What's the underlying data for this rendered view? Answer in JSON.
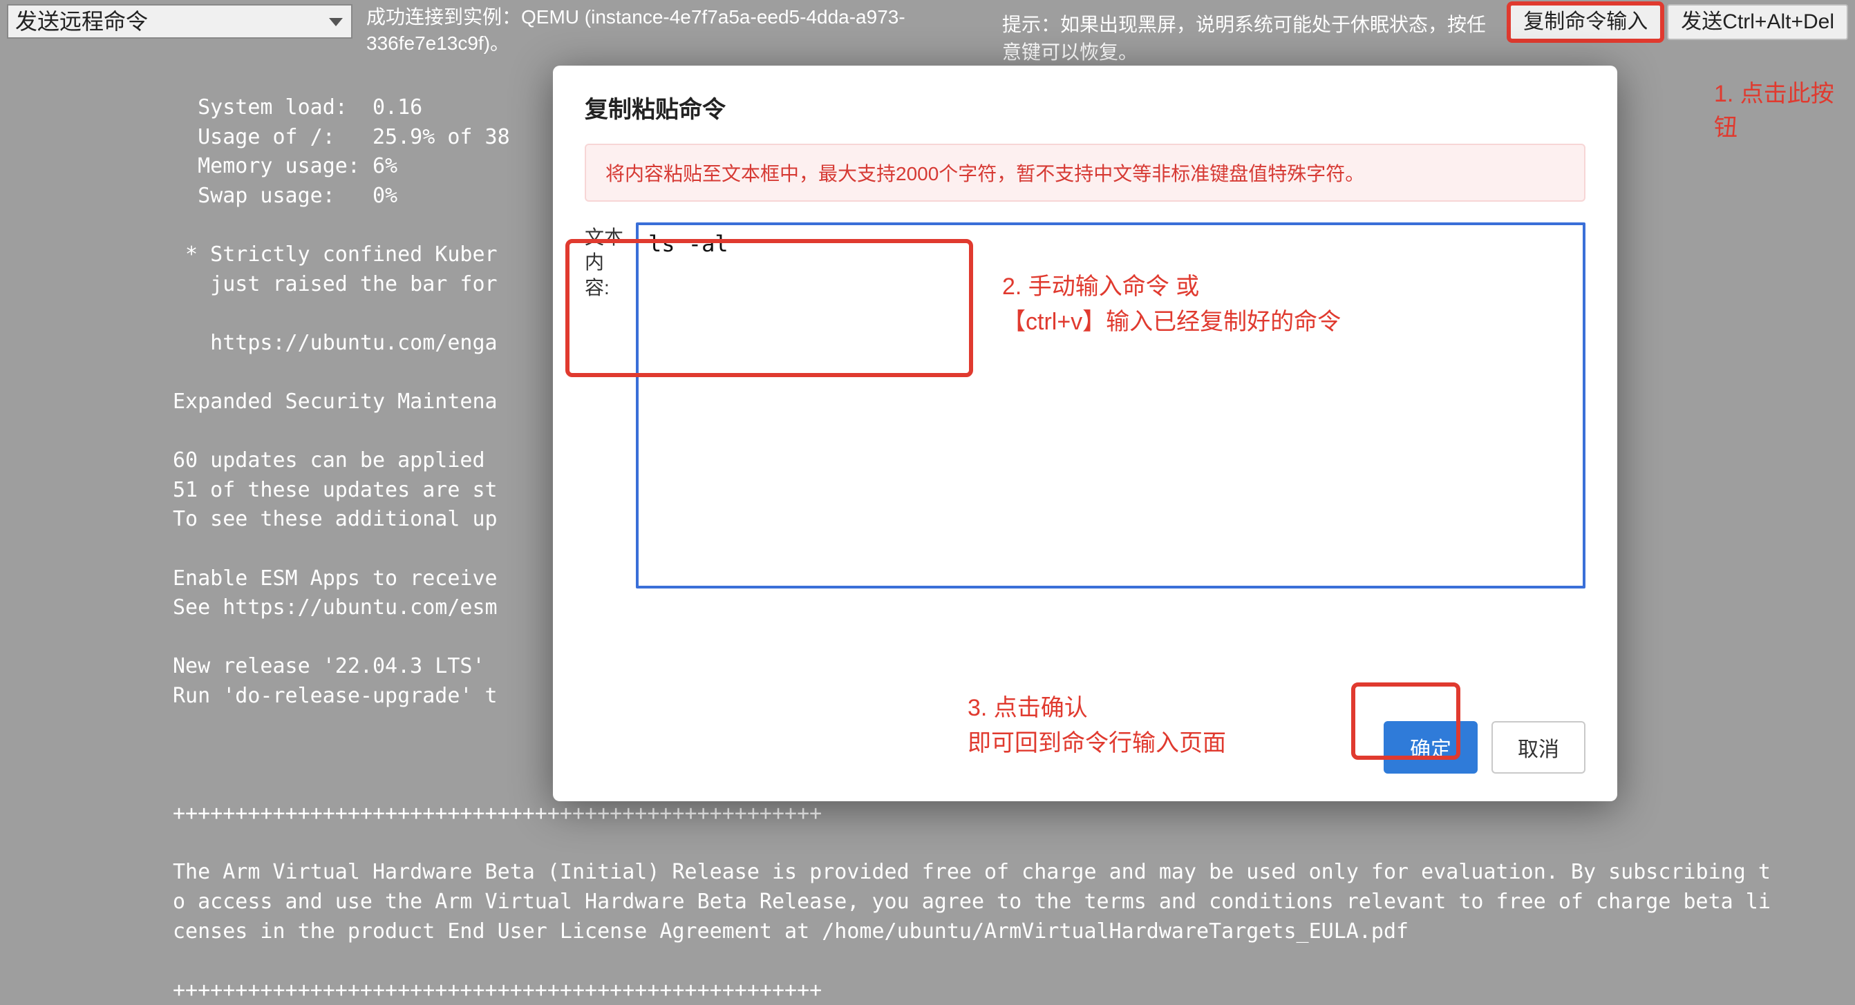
{
  "header": {
    "select_placeholder": "发送远程命令",
    "status": "成功连接到实例：QEMU (instance-4e7f7a5a-eed5-4dda-a973-336fe7e13c9f)。",
    "tip": "提示：如果出现黑屏，说明系统可能处于休眠状态，按任意键可以恢复。",
    "copy_btn": "复制命令输入",
    "cad_btn": "发送Ctrl+Alt+Del"
  },
  "terminal": {
    "lines": "  System load:  0.16\n  Usage of /:   25.9% of 38\n  Memory usage: 6%\n  Swap usage:   0%\n\n * Strictly confined Kuber\n   just raised the bar for\n\n   https://ubuntu.com/enga\n\nExpanded Security Maintena\n\n60 updates can be applied \n51 of these updates are st\nTo see these additional up\n\nEnable ESM Apps to receive\nSee https://ubuntu.com/esm\n\nNew release '22.04.3 LTS' \nRun 'do-release-upgrade' t\n\n\n\n++++++++++++++++++++++++++++++++++++++++++++++++++++\n\nThe Arm Virtual Hardware Beta (Initial) Release is provided free of charge and may be used only for evaluation. By subscribing t\no access and use the Arm Virtual Hardware Beta Release, you agree to the terms and conditions relevant to free of charge beta li\ncenses in the product End User License Agreement at /home/ubuntu/ArmVirtualHardwareTargets_EULA.pdf\n\n++++++++++++++++++++++++++++++++++++++++++++++++++++"
  },
  "modal": {
    "title": "复制粘贴命令",
    "warning": "将内容粘贴至文本框中，最大支持2000个字符，暂不支持中文等非标准键盘值特殊字符。",
    "label": "文本内容:",
    "textarea_value": "ls -al",
    "ok": "确定",
    "cancel": "取消"
  },
  "annotations": {
    "step1": "1. 点击此按钮",
    "step2_line1": "2. 手动输入命令 或",
    "step2_line2": "【ctrl+v】输入已经复制好的命令",
    "step3_line1": "3. 点击确认",
    "step3_line2": "即可回到命令行输入页面"
  }
}
